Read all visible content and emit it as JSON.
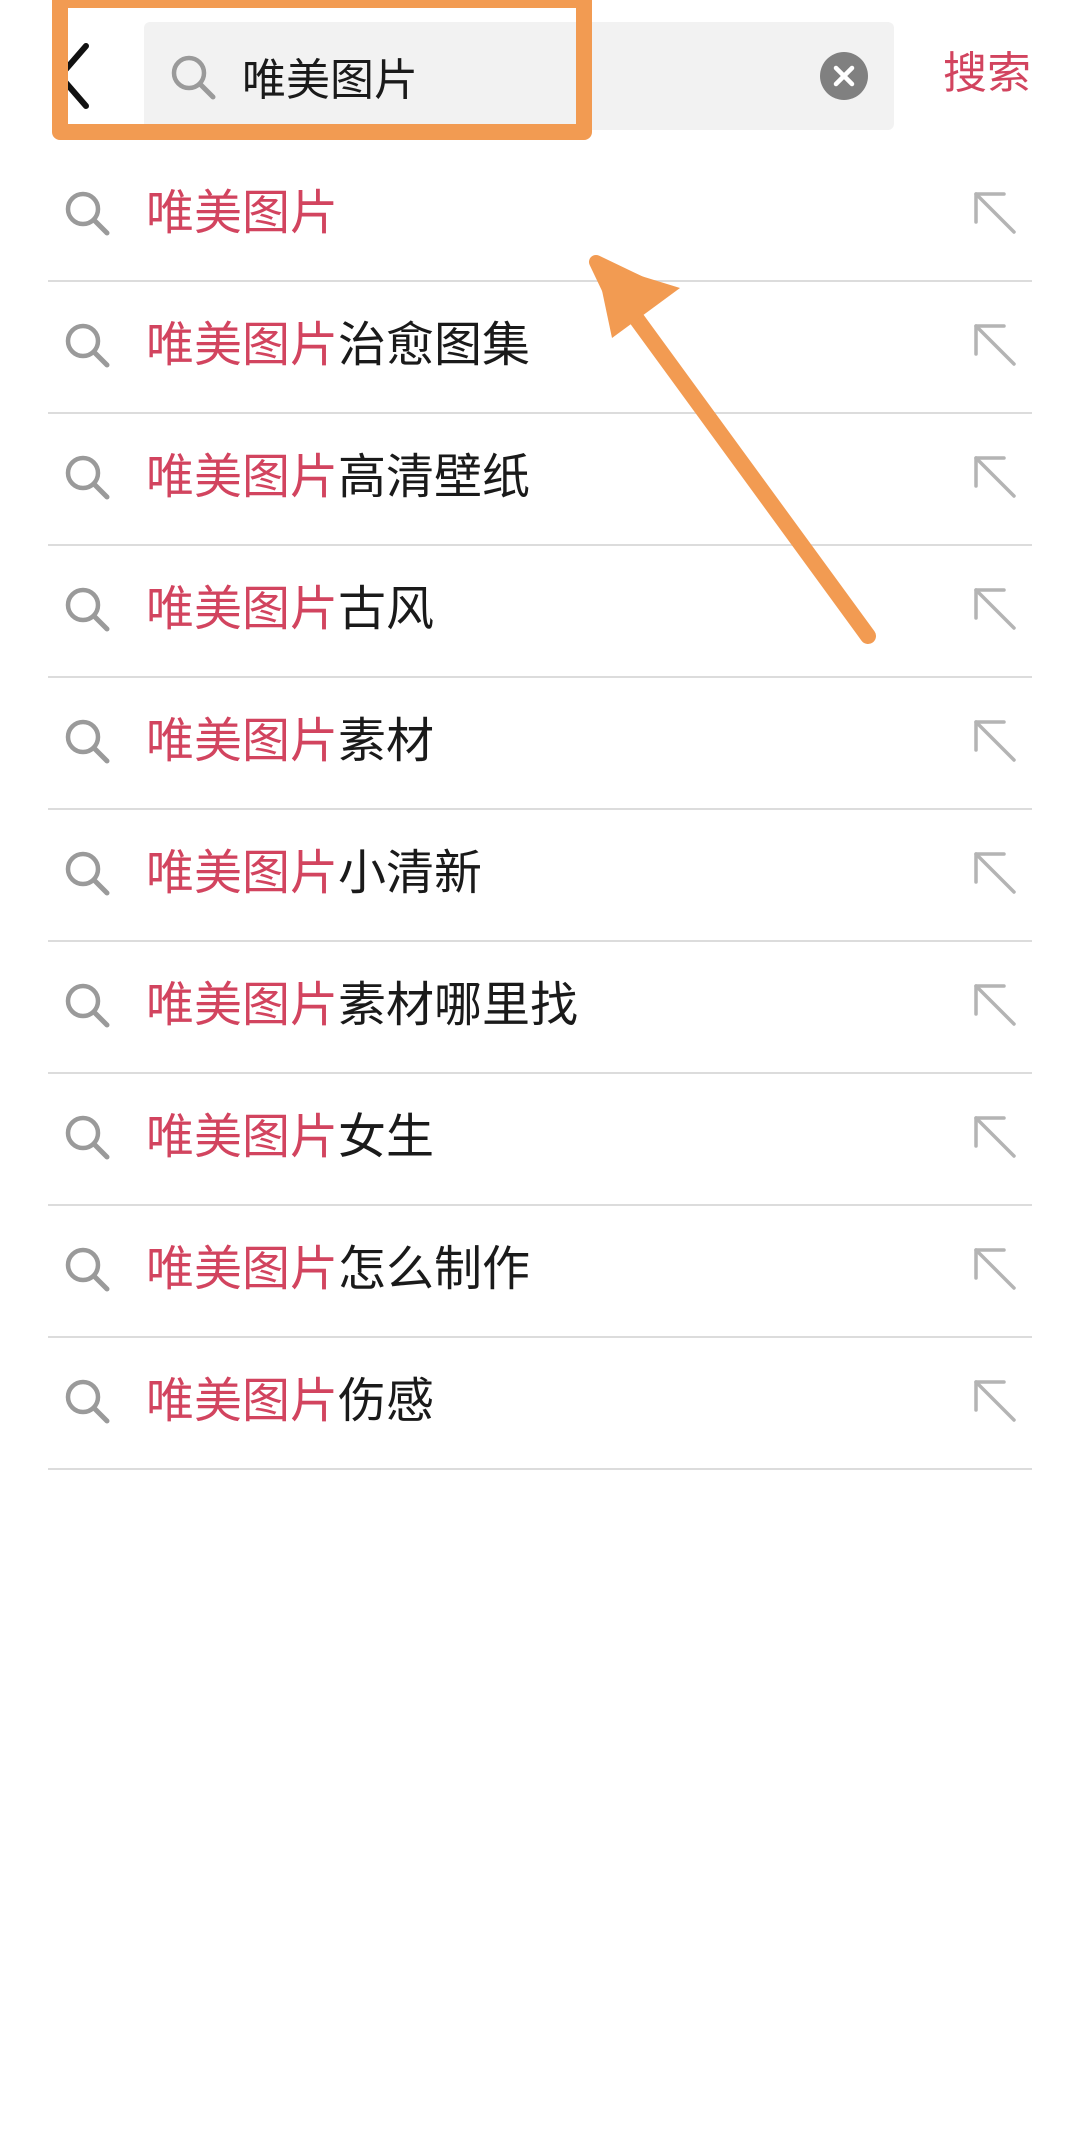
{
  "header": {
    "back_icon": "chevron-left-icon",
    "search_icon": "search-icon",
    "query": "唯美图片",
    "clear_icon": "clear-circle-icon",
    "search_button_label": "搜索"
  },
  "suggestions": [
    {
      "match": "唯美图片",
      "rest": ""
    },
    {
      "match": "唯美图片",
      "rest": "治愈图集"
    },
    {
      "match": "唯美图片",
      "rest": "高清壁纸"
    },
    {
      "match": "唯美图片",
      "rest": "古风"
    },
    {
      "match": "唯美图片",
      "rest": "素材"
    },
    {
      "match": "唯美图片",
      "rest": "小清新"
    },
    {
      "match": "唯美图片",
      "rest": "素材哪里找"
    },
    {
      "match": "唯美图片",
      "rest": "女生"
    },
    {
      "match": "唯美图片",
      "rest": "怎么制作"
    },
    {
      "match": "唯美图片",
      "rest": "伤感"
    }
  ],
  "suggestion_icons": {
    "leading": "search-icon",
    "trailing": "arrow-up-left-icon"
  },
  "colors": {
    "accent": "#d2445f",
    "annotation": "#f29b52",
    "text": "#1a1a1a",
    "divider": "#dcdcdc",
    "search_box_bg": "#f2f2f2"
  }
}
